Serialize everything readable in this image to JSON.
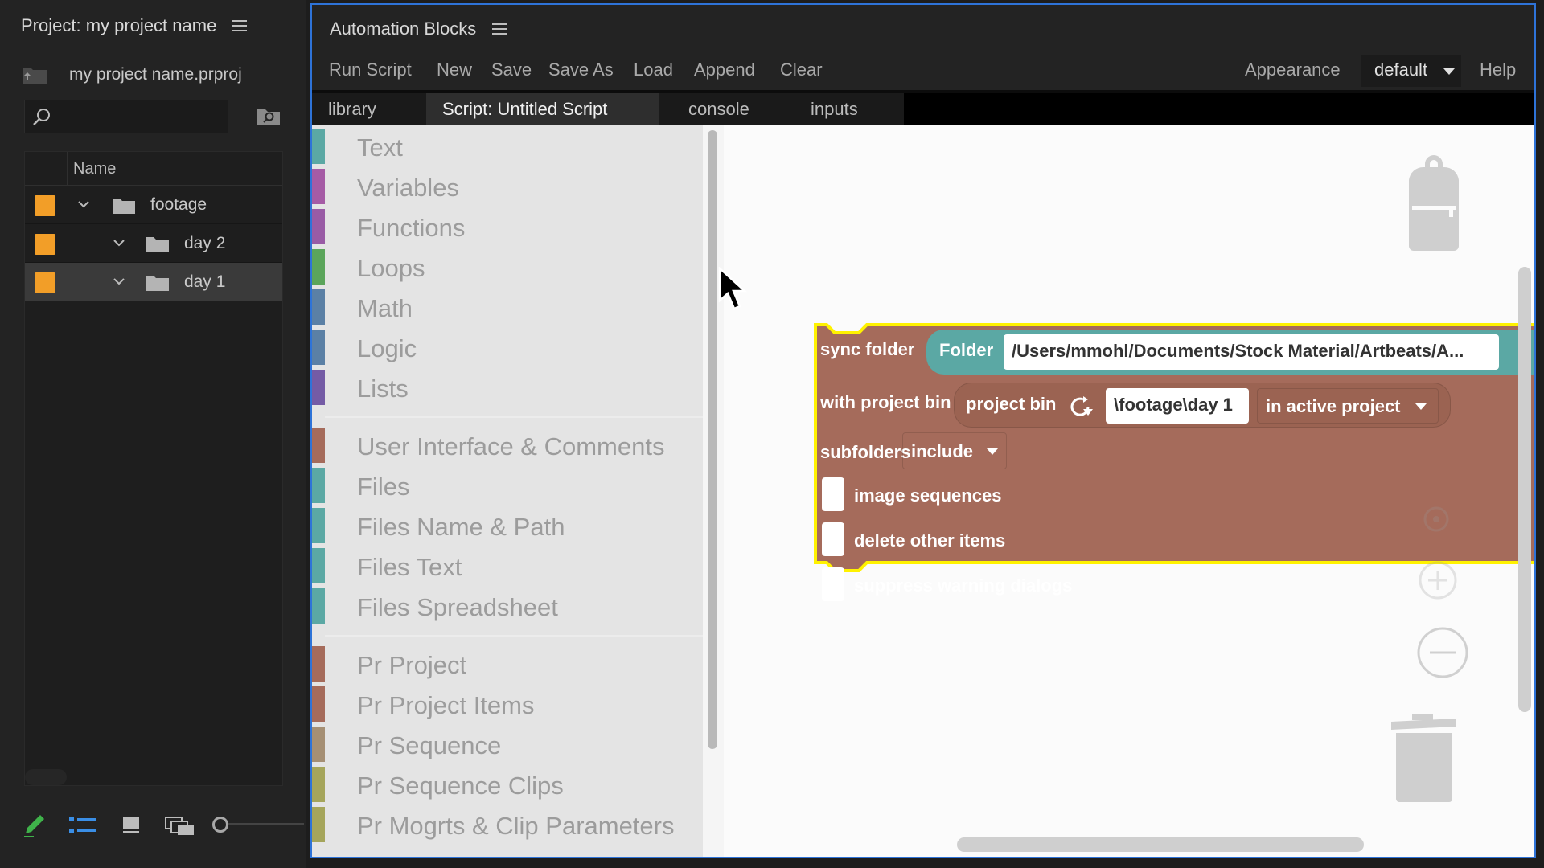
{
  "project_panel": {
    "title": "Project: my project name",
    "project_file": "my project name.prproj",
    "search": {
      "placeholder": ""
    },
    "table": {
      "name_header": "Name",
      "rows": [
        {
          "name": "footage",
          "expanded": true,
          "label_color": "#f29e28",
          "selected": false
        },
        {
          "name": "day 2",
          "expanded": true,
          "label_color": "#f29e28",
          "selected": false
        },
        {
          "name": "day 1",
          "expanded": true,
          "label_color": "#f29e28",
          "selected": true
        }
      ]
    },
    "toolbar_icons": [
      "pencil-icon",
      "list-view-icon",
      "icon-view-icon",
      "freeform-view-icon",
      "zoom-slider"
    ]
  },
  "automation_blocks": {
    "title": "Automation Blocks",
    "menu": {
      "run_script": "Run Script",
      "new": "New",
      "save": "Save",
      "save_as": "Save As",
      "load": "Load",
      "append": "Append",
      "clear": "Clear",
      "appearance": "Appearance",
      "theme": "default",
      "help": "Help"
    },
    "tabs": [
      {
        "label": "library",
        "active": false
      },
      {
        "label": "Script: Untitled Script",
        "active": true
      },
      {
        "label": "console",
        "active": false
      },
      {
        "label": "inputs",
        "active": false
      }
    ],
    "toolbox": {
      "categories": [
        {
          "label": "Text",
          "color": "#5ba8a4"
        },
        {
          "label": "Variables",
          "color": "#a55ba5"
        },
        {
          "label": "Functions",
          "color": "#995ba5"
        },
        {
          "label": "Loops",
          "color": "#5ba55b"
        },
        {
          "label": "Math",
          "color": "#5b80a5"
        },
        {
          "label": "Logic",
          "color": "#5b80a5"
        },
        {
          "label": "Lists",
          "color": "#745ba5"
        },
        {
          "label": "User Interface & Comments",
          "color": "#a56b5b"
        },
        {
          "label": "Files",
          "color": "#5ba8a4"
        },
        {
          "label": "Files Name & Path",
          "color": "#5ba8a4"
        },
        {
          "label": "Files Text",
          "color": "#5ba8a4"
        },
        {
          "label": "Files Spreadsheet",
          "color": "#5ba8a4"
        },
        {
          "label": "Pr Project",
          "color": "#a56b5b"
        },
        {
          "label": "Pr Project Items",
          "color": "#a56b5b"
        },
        {
          "label": "Pr Sequence",
          "color": "#a58f74"
        },
        {
          "label": "Pr Sequence Clips",
          "color": "#a5a55b"
        },
        {
          "label": "Pr Mogrts & Clip Parameters",
          "color": "#a5a55b"
        }
      ]
    },
    "block": {
      "color": "#a56b5b",
      "highlight": "#fff200",
      "sync_folder_label": "sync folder",
      "folder_label": "Folder",
      "folder_path": "/Users/mmohl/Documents/Stock Material/Artbeats/A...",
      "with_project_bin_label": "with project bin",
      "project_bin_label": "project bin",
      "bin_path": "\\footage\\day 1",
      "bin_scope": "in active project",
      "subfolders_label": "subfolders",
      "subfolders_value": "include",
      "checkboxes": [
        {
          "label": "image sequences",
          "checked": false
        },
        {
          "label": "delete other items",
          "checked": false
        },
        {
          "label": "suppress warning dialogs",
          "checked": false
        }
      ]
    }
  }
}
